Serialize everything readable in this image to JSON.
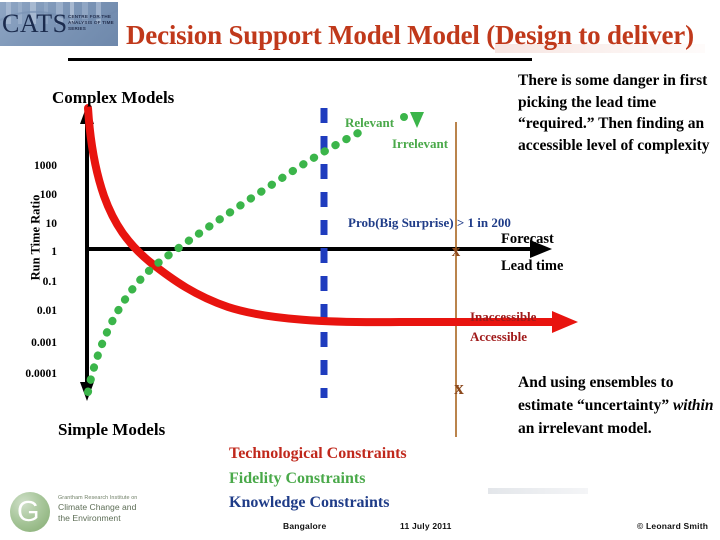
{
  "header": {
    "logo": {
      "acronym": "CATS",
      "subtitle": "CENTRE FOR THE ANALYSIS OF TIME SERIES"
    },
    "title": "Decision Support Model Model (Design to deliver)"
  },
  "plot": {
    "top_label": "Complex Models",
    "bottom_label": "Simple Models",
    "y_axis_title": "Run Time Ratio",
    "y_ticks": [
      "1000",
      "100",
      "10",
      "1",
      "0.1",
      "0.01",
      "0.001",
      "0.0001"
    ],
    "x_axis_label_line1": "Forecast",
    "x_axis_label_line2": "Lead time",
    "series_labels": {
      "relevant": "Relevant",
      "irrelevant": "Irrelevant",
      "inaccessible": "Inaccessible",
      "accessible": "Accessible"
    },
    "probability_annotation": "Prob(Big Surprise) > 1 in 200",
    "marker_symbol": "x"
  },
  "notes": {
    "top": "There is some danger in first picking the lead time “required.” Then finding an accessible level of complexity",
    "bottom_part1": "And using ensembles to estimate “uncertainty” ",
    "bottom_emphasis": "within",
    "bottom_part2": " an irrelevant model."
  },
  "constraints": [
    {
      "label": "Technological Constraints",
      "color": "#c0281c"
    },
    {
      "label": "Fidelity Constraints",
      "color": "#4aa94a"
    },
    {
      "label": "Knowledge Constraints",
      "color": "#1f3c88"
    }
  ],
  "institute": {
    "line1": "Grantham Research Institute on",
    "line2": "Climate Change and",
    "line3": "the Environment",
    "mark": "G"
  },
  "footer": {
    "place": "Bangalore",
    "date": "11 July 2011",
    "copyright": "© Leonard Smith"
  },
  "chart_data": {
    "type": "line",
    "title": "Decision Support Model Model (Design to deliver)",
    "xlabel": "Forecast Lead time",
    "ylabel": "Run Time Ratio",
    "ylim": [
      "0.0001",
      "1000"
    ],
    "y_scale": "log",
    "grid": false,
    "legend": "inline annotations",
    "series": [
      {
        "name": "Technological Constraints",
        "style": "solid-thick",
        "color": "#e8140f",
        "description": "Run time ratio falls steeply from above 1000 at short lead time and asymptotes near 0.01 at long lead time",
        "points": [
          [
            0,
            3000
          ],
          [
            0.02,
            300
          ],
          [
            0.06,
            60
          ],
          [
            0.15,
            10
          ],
          [
            0.3,
            1
          ],
          [
            0.45,
            0.2
          ],
          [
            0.6,
            0.03
          ],
          [
            0.8,
            0.015
          ],
          [
            1.0,
            0.013
          ]
        ]
      },
      {
        "name": "Fidelity / Knowledge Constraints",
        "style": "dotted-thick",
        "color": "#3bb54a",
        "description": "Relevance rises from below 0.0001 at short lead time through 1 near mid range and continues upward (irrelevant beyond)",
        "points": [
          [
            0.0,
            3e-05
          ],
          [
            0.02,
            0.0003
          ],
          [
            0.06,
            0.005
          ],
          [
            0.12,
            0.05
          ],
          [
            0.22,
            0.3
          ],
          [
            0.35,
            1.0
          ],
          [
            0.5,
            6
          ],
          [
            0.65,
            30
          ],
          [
            0.78,
            120
          ]
        ]
      }
    ],
    "annotations": [
      {
        "text": "Relevant",
        "color": "#4aa94a",
        "position": "above green curve"
      },
      {
        "text": "Irrelevant",
        "color": "#4aa94a",
        "position": "below green curve"
      },
      {
        "text": "Prob(Big Surprise) > 1 in 200",
        "color": "#1f3c88",
        "position": "right of blue dashed line"
      },
      {
        "text": "Inaccessible",
        "color": "#a01a1a",
        "position": "above red arrow"
      },
      {
        "text": "Accessible",
        "color": "#a01a1a",
        "position": "below red arrow"
      }
    ],
    "markers": [
      {
        "symbol": "x",
        "color": "#8c4a1e",
        "on": "black lead-time axis"
      },
      {
        "symbol": "x",
        "color": "#8c4a1e",
        "on": "lower brown vertical line"
      }
    ],
    "vertical_lines": [
      {
        "color": "#1f3cbe",
        "style": "dashed",
        "meaning": "probability threshold"
      },
      {
        "color": "#a8651f",
        "style": "solid-thin",
        "meaning": "chosen lead time"
      }
    ]
  }
}
